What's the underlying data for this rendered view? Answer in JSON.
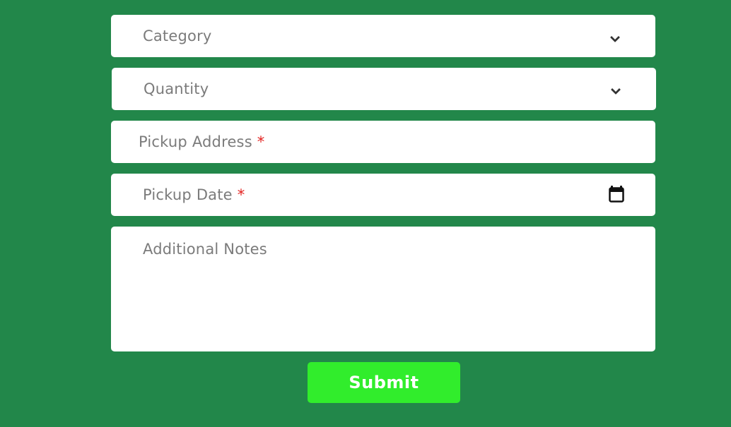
{
  "form": {
    "category": {
      "label": "Category",
      "icon": "chevron-down-icon"
    },
    "quantity": {
      "label": "Quantity",
      "icon": "chevron-down-icon"
    },
    "pickup_address": {
      "label": "Pickup Address",
      "required_marker": "*"
    },
    "pickup_date": {
      "label": "Pickup Date",
      "required_marker": "*",
      "icon": "calendar-icon"
    },
    "notes": {
      "label": "Additional Notes"
    },
    "submit_label": "Submit"
  },
  "colors": {
    "background": "#22874a",
    "field_background": "#ffffff",
    "label_text": "#7b7b7b",
    "required_marker": "#e3211f",
    "submit_background": "#31ed2c",
    "submit_text": "#ffffff"
  }
}
